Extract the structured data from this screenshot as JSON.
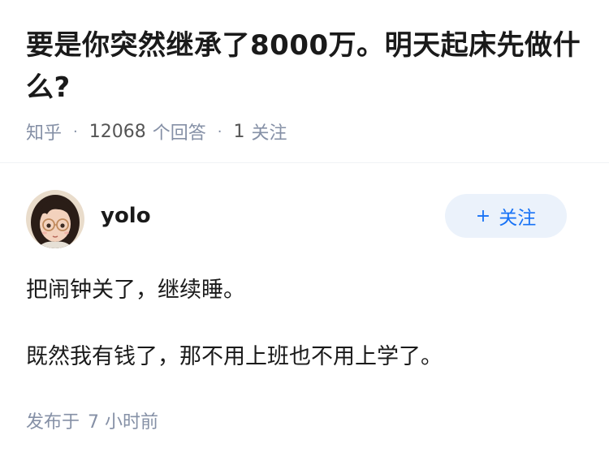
{
  "question": {
    "title": "要是你突然继承了8000万。明天起床先做什么?",
    "source": "知乎",
    "answer_count": "12068",
    "answer_label": "个回答",
    "follow_count": "1",
    "follow_label": "关注"
  },
  "answer": {
    "author": "yolo",
    "follow_button": "关注",
    "follow_icon": "plus-icon",
    "paragraphs": [
      "把闹钟关了，继续睡。",
      "既然我有钱了，那不用上班也不用上学了。"
    ],
    "publish_prefix": "发布于",
    "publish_time": "7 小时前"
  },
  "colors": {
    "accent": "#1772f6",
    "follow_bg": "#ebf2fb",
    "meta": "#8590a6"
  }
}
